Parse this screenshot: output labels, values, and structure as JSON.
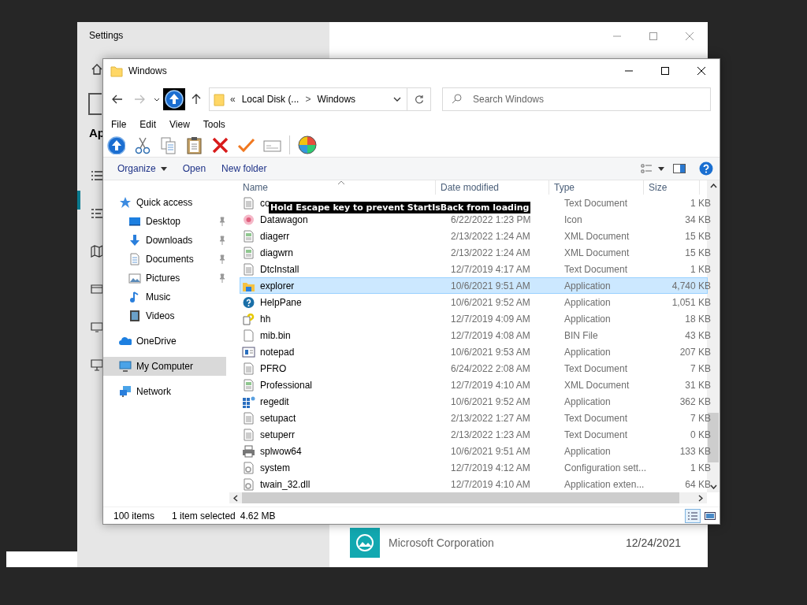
{
  "settings": {
    "title": "Settings",
    "partial_heading": "Ap",
    "app": {
      "publisher": "Microsoft Corporation",
      "date": "12/24/2021"
    }
  },
  "explorer": {
    "title": "Windows",
    "address": {
      "overflow": "«",
      "separator": ">",
      "segments": [
        "Local Disk (...",
        "Windows"
      ]
    },
    "search": {
      "placeholder": "Search Windows"
    },
    "menu": [
      "File",
      "Edit",
      "View",
      "Tools"
    ],
    "commands": [
      {
        "label": "Organize",
        "dropdown": true
      },
      {
        "label": "Open",
        "dropdown": false
      },
      {
        "label": "New folder",
        "dropdown": false
      }
    ],
    "nav": [
      {
        "label": "Quick access",
        "kind": "star",
        "selected": false,
        "children": [
          {
            "label": "Desktop",
            "kind": "desktop",
            "selected": false,
            "pinned": true
          },
          {
            "label": "Downloads",
            "kind": "download",
            "selected": false,
            "pinned": true
          },
          {
            "label": "Documents",
            "kind": "document",
            "selected": false,
            "pinned": true
          },
          {
            "label": "Pictures",
            "kind": "pictures",
            "selected": false,
            "pinned": true
          },
          {
            "label": "Music",
            "kind": "music",
            "selected": false,
            "pinned": false
          },
          {
            "label": "Videos",
            "kind": "video",
            "selected": false,
            "pinned": false
          }
        ]
      },
      {
        "label": "OneDrive",
        "kind": "cloud",
        "selected": false
      },
      {
        "label": "My Computer",
        "kind": "computer",
        "selected": true
      },
      {
        "label": "Network",
        "kind": "network",
        "selected": false
      }
    ],
    "columns": [
      "Name",
      "Date modified",
      "Type",
      "Size"
    ],
    "rows": [
      {
        "name": "co",
        "type": "Text Document",
        "size": "1 KB",
        "kind": "text",
        "selected": false
      },
      {
        "name": "Datawagon",
        "date": "6/22/2022 1:23 PM",
        "type": "Icon",
        "size": "34 KB",
        "kind": "image",
        "selected": false
      },
      {
        "name": "diagerr",
        "date": "2/13/2022 1:24 AM",
        "type": "XML Document",
        "size": "15 KB",
        "kind": "xml",
        "selected": false
      },
      {
        "name": "diagwrn",
        "date": "2/13/2022 1:24 AM",
        "type": "XML Document",
        "size": "15 KB",
        "kind": "xml",
        "selected": false
      },
      {
        "name": "DtcInstall",
        "date": "12/7/2019 4:17 AM",
        "type": "Text Document",
        "size": "1 KB",
        "kind": "text",
        "selected": false
      },
      {
        "name": "explorer",
        "date": "10/6/2021 9:51 AM",
        "type": "Application",
        "size": "4,740 KB",
        "kind": "folderapp",
        "selected": true
      },
      {
        "name": "HelpPane",
        "date": "10/6/2021 9:52 AM",
        "type": "Application",
        "size": "1,051 KB",
        "kind": "help",
        "selected": false
      },
      {
        "name": "hh",
        "date": "12/7/2019 4:09 AM",
        "type": "Application",
        "size": "18 KB",
        "kind": "helpdoc",
        "selected": false
      },
      {
        "name": "mib.bin",
        "date": "12/7/2019 4:08 AM",
        "type": "BIN File",
        "size": "43 KB",
        "kind": "blank",
        "selected": false
      },
      {
        "name": "notepad",
        "date": "10/6/2021 9:53 AM",
        "type": "Application",
        "size": "207 KB",
        "kind": "window",
        "selected": false
      },
      {
        "name": "PFRO",
        "date": "6/24/2022 2:08 AM",
        "type": "Text Document",
        "size": "7 KB",
        "kind": "text",
        "selected": false
      },
      {
        "name": "Professional",
        "date": "12/7/2019 4:10 AM",
        "type": "XML Document",
        "size": "31 KB",
        "kind": "xml",
        "selected": false
      },
      {
        "name": "regedit",
        "date": "10/6/2021 9:52 AM",
        "type": "Application",
        "size": "362 KB",
        "kind": "grid",
        "selected": false
      },
      {
        "name": "setupact",
        "date": "2/13/2022 1:27 AM",
        "type": "Text Document",
        "size": "7 KB",
        "kind": "text",
        "selected": false
      },
      {
        "name": "setuperr",
        "date": "2/13/2022 1:23 AM",
        "type": "Text Document",
        "size": "0 KB",
        "kind": "text",
        "selected": false
      },
      {
        "name": "splwow64",
        "date": "10/6/2021 9:51 AM",
        "type": "Application",
        "size": "133 KB",
        "kind": "printer",
        "selected": false
      },
      {
        "name": "system",
        "date": "12/7/2019 4:12 AM",
        "type": "Configuration sett...",
        "size": "1 KB",
        "kind": "config",
        "selected": false
      },
      {
        "name": "twain_32.dll",
        "date": "12/7/2019 4:10 AM",
        "type": "Application exten...",
        "size": "64 KB",
        "kind": "config",
        "selected": false
      }
    ],
    "tooltip": "Hold Escape key to prevent StartIsBack from loading",
    "status": {
      "count": "100 items",
      "selection": "1 item selected",
      "size": "4.62 MB"
    }
  }
}
